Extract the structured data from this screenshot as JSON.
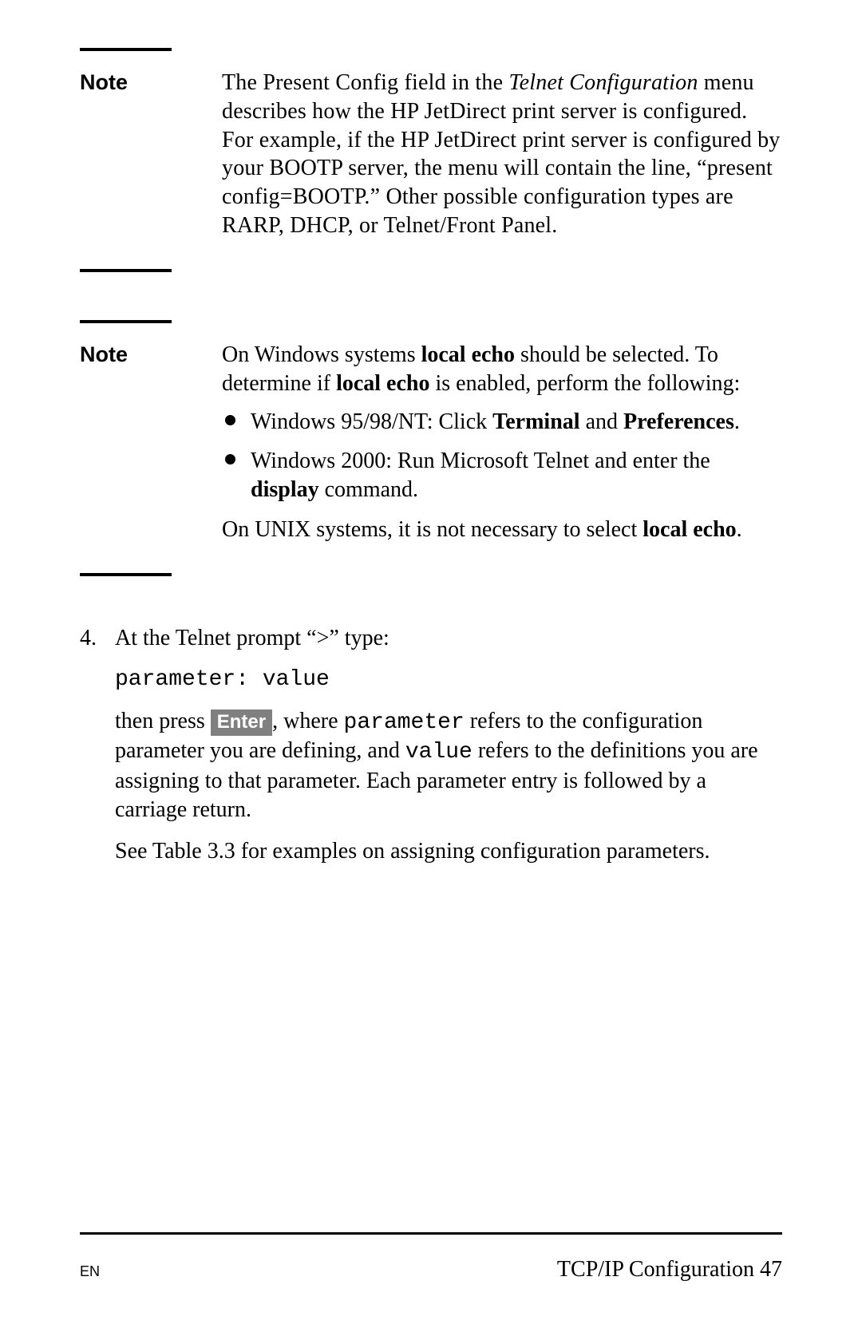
{
  "note1": {
    "label": "Note",
    "text_pre": "The Present Config field in the ",
    "italic": "Telnet Configuration",
    "text_post": " menu describes how the HP JetDirect print server is configured. For example, if the HP JetDirect print server is configured by your BOOTP server, the menu will contain the line, “present config=BOOTP.” Other possible configuration types are RARP, DHCP, or Telnet/Front Panel."
  },
  "note2": {
    "label": "Note",
    "p1_a": "On Windows systems ",
    "p1_b": "local echo",
    "p1_c": " should be selected. To determine if ",
    "p1_d": "local echo",
    "p1_e": " is enabled, perform the following:",
    "bullets": [
      {
        "a": "Windows 95/98/NT: Click ",
        "b": "Terminal",
        "c": " and ",
        "d": "Preferences",
        "e": "."
      },
      {
        "a": "Windows 2000: Run Microsoft Telnet and enter the ",
        "b": "display",
        "c": " command."
      }
    ],
    "p2_a": "On UNIX systems, it is not necessary to select ",
    "p2_b": "local echo",
    "p2_c": "."
  },
  "step4": {
    "num": "4.",
    "line1": "At the Telnet prompt “>” type:",
    "code": "parameter: value",
    "line3_a": "then press ",
    "key": "Enter",
    "line3_b": ", where ",
    "mono1": "parameter",
    "line3_c": " refers to the configuration parameter you are defining, and ",
    "mono2": "value",
    "line3_d": " refers to the definitions you are assigning to that parameter. Each parameter entry is followed by a carriage return.",
    "line4": "See Table 3.3 for examples on assigning configuration parameters."
  },
  "footer": {
    "left": "EN",
    "right_label": "TCP/IP Configuration ",
    "right_page": "47"
  }
}
